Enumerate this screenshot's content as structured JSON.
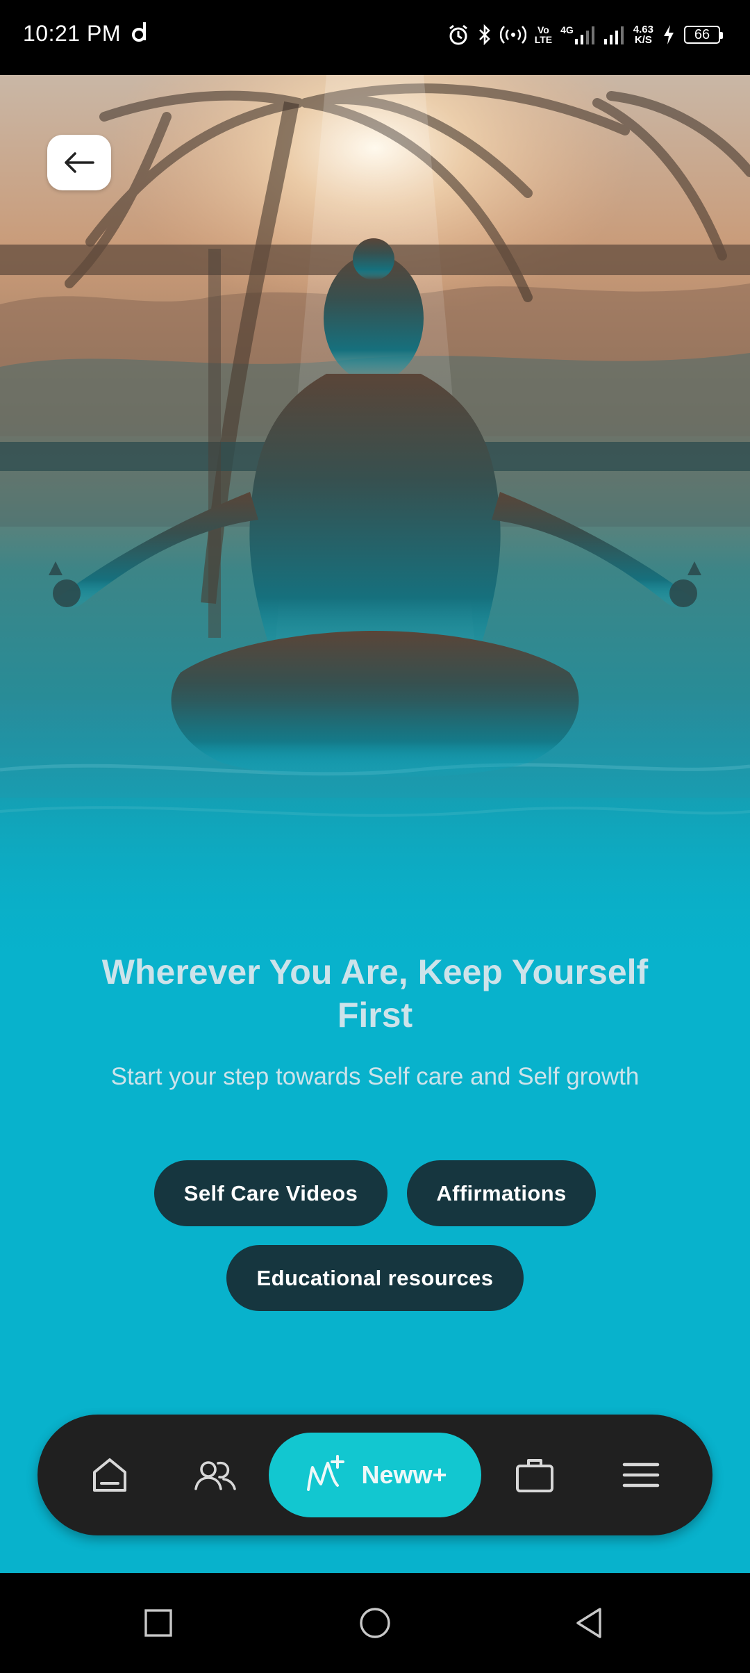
{
  "status_bar": {
    "time": "10:21 PM",
    "volte_top": "Vo",
    "volte_bottom": "LTE",
    "network_type": "4G",
    "speed_value": "4.63",
    "speed_unit": "K/S",
    "battery_level": "66",
    "icons": [
      "carrier-d-icon",
      "alarm-icon",
      "bluetooth-icon",
      "hotspot-icon",
      "signal-icon",
      "charging-icon",
      "battery-icon"
    ]
  },
  "header": {
    "back_icon": "arrow-left-icon"
  },
  "hero": {
    "title": "Wherever You Are, Keep Yourself First",
    "subtitle": "Start your step towards Self care and Self growth"
  },
  "categories": [
    {
      "label": "Self Care Videos"
    },
    {
      "label": "Affirmations"
    },
    {
      "label": "Educational resources"
    }
  ],
  "bottom_nav": {
    "center_label": "Neww+",
    "items": [
      "home-icon",
      "community-icon",
      "neww-plus-logo-icon",
      "briefcase-icon",
      "menu-icon"
    ]
  },
  "colors": {
    "accent": "#12c7d0",
    "background": "#08b2cc",
    "pill": "#16363f",
    "nav": "#202020"
  }
}
